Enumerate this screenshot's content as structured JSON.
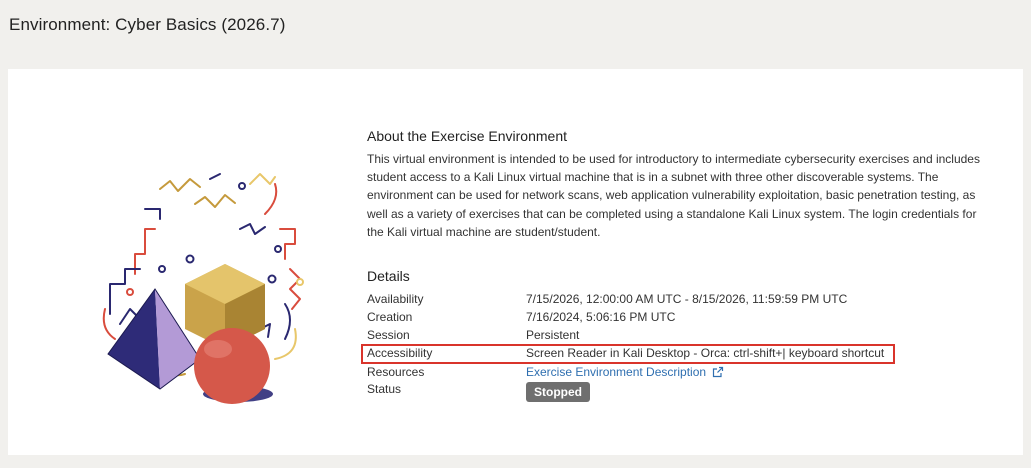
{
  "header": {
    "title": "Environment: Cyber Basics (2026.7)"
  },
  "about": {
    "heading": "About the Exercise Environment",
    "text": "This virtual environment is intended to be used for introductory to intermediate cybersecurity exercises and includes student access to a Kali Linux virtual machine that is in a subnet with three other discoverable systems. The environment can be used for network scans, web application vulnerability exploitation, basic penetration testing, as well as a variety of exercises that can be completed using a standalone Kali Linux system. The login credentials for the Kali virtual machine are student/student."
  },
  "details": {
    "heading": "Details",
    "availability": {
      "label": "Availability",
      "value": "7/15/2026, 12:00:00 AM UTC - 8/15/2026, 11:59:59 PM UTC"
    },
    "creation": {
      "label": "Creation",
      "value": "7/16/2024, 5:06:16 PM UTC"
    },
    "session": {
      "label": "Session",
      "value": "Persistent"
    },
    "accessibility": {
      "label": "Accessibility",
      "value": "Screen Reader in Kali Desktop - Orca: ctrl-shift+| keyboard shortcut"
    },
    "resources": {
      "label": "Resources",
      "value": "Exercise Environment Description",
      "icon": "external-link-icon"
    },
    "status": {
      "label": "Status",
      "value": "Stopped"
    }
  },
  "colors": {
    "background": "#f1f0ed",
    "card": "#ffffff",
    "link": "#2f6fb0",
    "highlight": "#d9342b",
    "status_badge": "#6f6f6f"
  }
}
